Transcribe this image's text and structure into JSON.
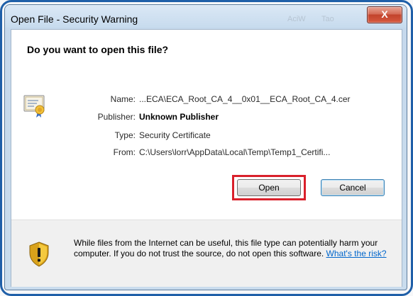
{
  "window": {
    "title": "Open File - Security Warning",
    "ghost_text_1": "AciW",
    "ghost_text_2": "Tao",
    "close_glyph": "X"
  },
  "dialog": {
    "heading": "Do you want to open this file?",
    "fields": [
      {
        "label": "Name:",
        "value": "...ECA\\ECA_Root_CA_4__0x01__ECA_Root_CA_4.cer"
      },
      {
        "label": "Publisher:",
        "value": "Unknown Publisher"
      },
      {
        "label": "Type:",
        "value": "Security Certificate"
      },
      {
        "label": "From:",
        "value": "C:\\Users\\lorr\\AppData\\Local\\Temp\\Temp1_Certifi..."
      }
    ],
    "buttons": {
      "open": "Open",
      "cancel": "Cancel"
    },
    "warning": {
      "text": "While files from the Internet can be useful, this file type can potentially harm your computer. If you do not trust the source, do not open this software.",
      "link": "What's the risk?"
    },
    "icons": {
      "certificate": "certificate-icon",
      "shield": "shield-warning-icon"
    }
  },
  "colors": {
    "frame_border": "#1f5fa8",
    "highlight": "#d9202b",
    "link": "#0066cc"
  }
}
